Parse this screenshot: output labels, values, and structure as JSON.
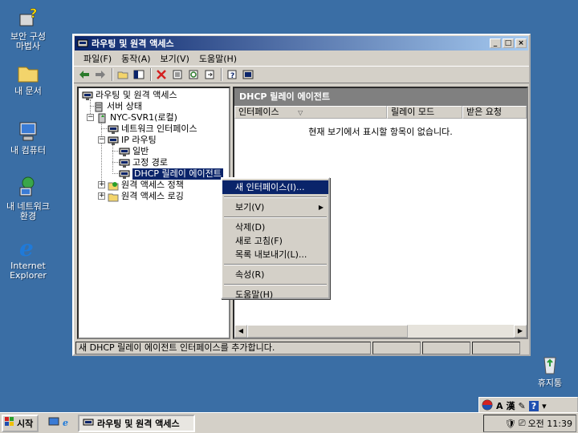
{
  "desktop": {
    "icons": [
      {
        "label": "보안 구성\n마법사"
      },
      {
        "label": "내 문서"
      },
      {
        "label": "내 컴퓨터"
      },
      {
        "label": "내 네트워크\n환경"
      },
      {
        "label": "Internet\nExplorer"
      },
      {
        "label": "휴지통"
      }
    ]
  },
  "window": {
    "title": "라우팅 및 원격 액세스",
    "menu": [
      "파일(F)",
      "동작(A)",
      "보기(V)",
      "도움말(H)"
    ]
  },
  "tree": {
    "items": [
      {
        "label": "라우팅 및 원격 액세스"
      },
      {
        "label": "서버 상태"
      },
      {
        "label": "NYC-SVR1(로컬)"
      },
      {
        "label": "네트워크 인터페이스"
      },
      {
        "label": "IP 라우팅"
      },
      {
        "label": "일반"
      },
      {
        "label": "고정 경로"
      },
      {
        "label": "DHCP 릴레이 에이전트"
      },
      {
        "label": "원격 액세스 정책"
      },
      {
        "label": "원격 액세스 로깅"
      }
    ]
  },
  "right_pane": {
    "header": "DHCP 릴레이 에이전트",
    "columns": [
      "인터페이스",
      "릴레이 모드",
      "받은 요청"
    ],
    "empty_message": "현재 보기에서 표시할 항목이 없습니다."
  },
  "context_menu": {
    "items": [
      "새 인터페이스(I)...",
      "보기(V)",
      "삭제(D)",
      "새로 고침(F)",
      "목록 내보내기(L)...",
      "속성(R)",
      "도움말(H)"
    ]
  },
  "status_bar": {
    "text": "새 DHCP 릴레이 에이전트 인터페이스를 추가합니다."
  },
  "language_bar": {
    "mode": "A",
    "hanja": "漢"
  },
  "taskbar": {
    "start_label": "시작",
    "task_label": "라우팅 및 원격 액세스",
    "clock": "오전 11:39"
  },
  "colors": {
    "desktop": "#3a6ea5",
    "title_active": "#0a246a",
    "selection": "#0a246a",
    "face": "#d4d0c8"
  }
}
